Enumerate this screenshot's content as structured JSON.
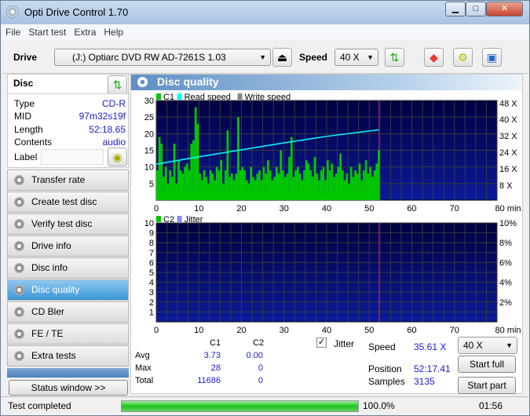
{
  "window": {
    "title": "Opti Drive Control 1.70",
    "minimize": "▁",
    "maximize": "□",
    "close": "✕"
  },
  "menu": [
    "File",
    "Start test",
    "Extra",
    "Help"
  ],
  "toolbar": {
    "drive_label": "Drive",
    "drive_value": "(J:)   Optiarc DVD RW AD-7261S 1.03",
    "speed_label": "Speed",
    "speed_value": "40 X"
  },
  "disc": {
    "title": "Disc",
    "fields": [
      {
        "k": "Type",
        "v": "CD-R"
      },
      {
        "k": "MID",
        "v": "97m32s19f"
      },
      {
        "k": "Length",
        "v": "52:18.65"
      },
      {
        "k": "Contents",
        "v": "audio"
      }
    ],
    "label_key": "Label",
    "label_value": ""
  },
  "nav": [
    "Transfer rate",
    "Create test disc",
    "Verify test disc",
    "Drive info",
    "Disc info",
    "Disc quality",
    "CD Bler",
    "FE / TE",
    "Extra tests"
  ],
  "nav_active": "Disc quality",
  "status_window": "Status window >>",
  "panel_title": "Disc quality",
  "chart_data": [
    {
      "type": "bar",
      "legend": [
        "C1",
        "Read speed",
        "Write speed"
      ],
      "colors": {
        "C1": "#00c800",
        "Read speed": "#00ffff",
        "Write speed": "#888888"
      },
      "xlim": [
        0,
        80
      ],
      "ylim": [
        0,
        30
      ],
      "xticks": [
        "0",
        "10",
        "20",
        "30",
        "40",
        "50",
        "60",
        "70",
        "80 min"
      ],
      "yticks": [
        "5",
        "10",
        "15",
        "20",
        "25",
        "30"
      ],
      "y2ticks": [
        "8 X",
        "16 X",
        "24 X",
        "32 X",
        "40 X",
        "48 X"
      ],
      "y2lim": [
        0,
        48
      ],
      "end_min": 52.3,
      "c1_step_min": 0.5,
      "c1": [
        9,
        19,
        17,
        7,
        10,
        5,
        9,
        7,
        17,
        5,
        12,
        9,
        8,
        10,
        11,
        9,
        17,
        18,
        28,
        23,
        8,
        6,
        9,
        7,
        5,
        9,
        8,
        6,
        10,
        9,
        12,
        5,
        9,
        21,
        7,
        8,
        6,
        8,
        25,
        9,
        10,
        9,
        6,
        5,
        10,
        7,
        6,
        8,
        9,
        6,
        10,
        8,
        12,
        9,
        6,
        7,
        10,
        8,
        15,
        9,
        7,
        8,
        13,
        19,
        7,
        9,
        10,
        8,
        6,
        9,
        12,
        11,
        9,
        7,
        13,
        8,
        6,
        9,
        10,
        6,
        12,
        9,
        11,
        7,
        8,
        10,
        14,
        9,
        6,
        8,
        5,
        10,
        7,
        9,
        8,
        11,
        6,
        9,
        12,
        8,
        10,
        7,
        9,
        11,
        15
      ],
      "read_speed_x": [
        0,
        10,
        20,
        30,
        40,
        52.3
      ],
      "read_speed": [
        17.6,
        21.2,
        24.6,
        28.0,
        31.2,
        34.4
      ]
    },
    {
      "type": "bar",
      "legend": [
        "C2",
        "Jitter"
      ],
      "colors": {
        "C2": "#00c800",
        "Jitter": "#8888ff"
      },
      "xlim": [
        0,
        80
      ],
      "ylim": [
        0,
        10
      ],
      "xticks": [
        "0",
        "10",
        "20",
        "30",
        "40",
        "50",
        "60",
        "70",
        "80 min"
      ],
      "yticks": [
        "1",
        "2",
        "3",
        "4",
        "5",
        "6",
        "7",
        "8",
        "9",
        "10"
      ],
      "y2ticks": [
        "2%",
        "4%",
        "6%",
        "8%",
        "10%"
      ],
      "end_min": 52.3
    }
  ],
  "stats": {
    "headers": [
      "C1",
      "C2"
    ],
    "rows": [
      {
        "k": "Avg",
        "c1": "3.73",
        "c2": "0.00"
      },
      {
        "k": "Max",
        "c1": "28",
        "c2": "0"
      },
      {
        "k": "Total",
        "c1": "11686",
        "c2": "0"
      }
    ],
    "jitter_label": "Jitter",
    "jitter_checked": true,
    "speed_label": "Speed",
    "speed_value": "35.61 X",
    "speed_select": "40 X",
    "position_label": "Position",
    "position_value": "52:17.41",
    "samples_label": "Samples",
    "samples_value": "3135",
    "start_full": "Start full",
    "start_part": "Start part"
  },
  "status": {
    "text": "Test completed",
    "progress": 100,
    "progress_text": "100.0%",
    "time": "01:56"
  }
}
